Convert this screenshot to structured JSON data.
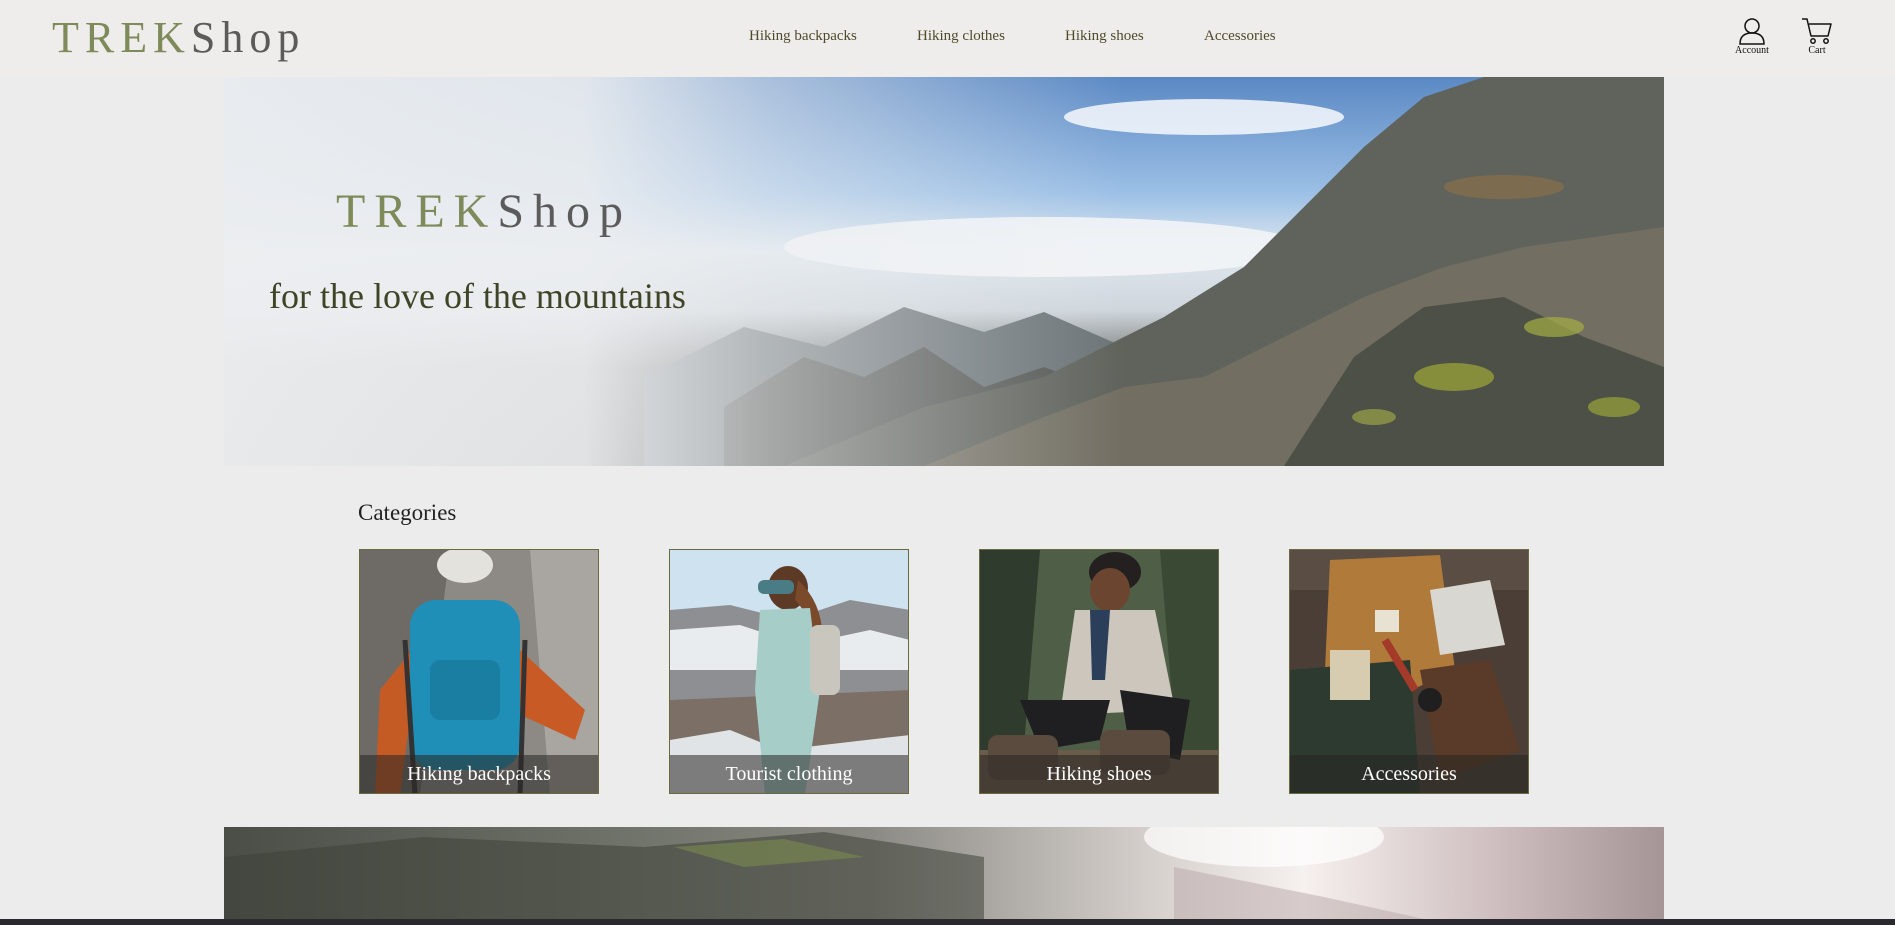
{
  "header": {
    "logo": {
      "part1": "TREK",
      "part2": "Shop"
    },
    "nav": [
      {
        "label": "Hiking backpacks"
      },
      {
        "label": "Hiking clothes"
      },
      {
        "label": "Hiking shoes"
      },
      {
        "label": "Accessories"
      }
    ],
    "account": {
      "label": "Account",
      "icon": "user-icon"
    },
    "cart": {
      "label": "Cart",
      "icon": "cart-icon"
    }
  },
  "hero": {
    "logo": {
      "part1": "TREK",
      "part2": "Shop"
    },
    "tagline": "for the love of the mountains"
  },
  "categories": {
    "title": "Categories",
    "items": [
      {
        "label": "Hiking backpacks"
      },
      {
        "label": "Tourist clothing"
      },
      {
        "label": "Hiking shoes"
      },
      {
        "label": "Accessories"
      }
    ]
  },
  "colors": {
    "brand_green": "#7e8a5a",
    "brand_gray": "#5b5b5b",
    "header_bg": "#efedeb",
    "page_bg": "#ececec"
  }
}
